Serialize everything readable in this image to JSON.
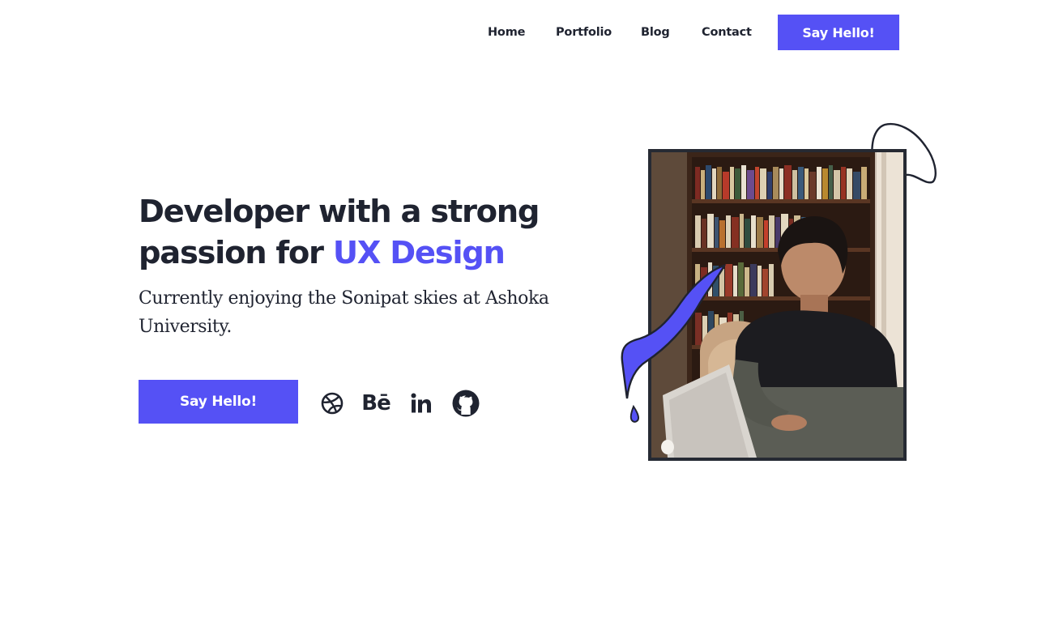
{
  "nav": {
    "links": [
      {
        "label": "Home"
      },
      {
        "label": "Portfolio"
      },
      {
        "label": "Blog"
      },
      {
        "label": "Contact"
      }
    ],
    "cta_label": "Say Hello!"
  },
  "hero": {
    "title_line1": "Developer with a strong",
    "title_line2_prefix": "passion for ",
    "title_accent": "UX Design",
    "subtitle": "Currently enjoying the Sonipat skies at Ashoka University.",
    "cta_label": "Say Hello!",
    "social_icons": [
      "dribbble-icon",
      "behance-icon",
      "linkedin-icon",
      "github-icon"
    ],
    "behance_glyph": "Bē",
    "linkedin_glyph": "in"
  },
  "colors": {
    "accent": "#5551f5",
    "text": "#1f2330",
    "background": "#ffffff"
  }
}
